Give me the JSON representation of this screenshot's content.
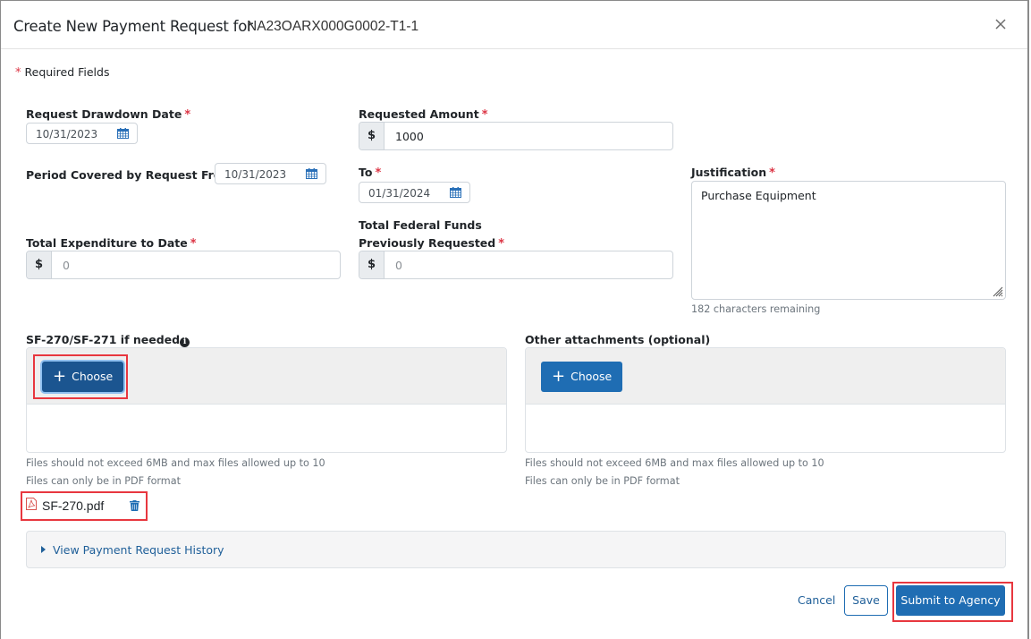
{
  "header": {
    "title": "Create New Payment Request for",
    "award_id": "NA23OARX000G0002-T1-1",
    "close_icon": "close-icon"
  },
  "required_note": {
    "marker": "*",
    "text": "Required Fields"
  },
  "fields": {
    "request_drawdown_date": {
      "label": "Request Drawdown Date",
      "value": "10/31/2023",
      "icon": "calendar-icon"
    },
    "requested_amount": {
      "label": "Requested Amount",
      "prefix": "$",
      "value": "1000"
    },
    "period_from": {
      "label": "Period Covered by Request From",
      "value": "10/31/2023",
      "icon": "calendar-icon"
    },
    "period_to": {
      "label": "To",
      "value": "01/31/2024",
      "icon": "calendar-icon"
    },
    "justification": {
      "label": "Justification",
      "value": "Purchase Equipment",
      "remaining": "182 characters remaining"
    },
    "total_expenditure": {
      "label": "Total Expenditure to Date",
      "prefix": "$",
      "placeholder": "0"
    },
    "federal_funds": {
      "label_line1": "Total Federal Funds",
      "label_line2": "Previously Requested",
      "prefix": "$",
      "placeholder": "0"
    }
  },
  "required_marker": "*",
  "attachments": {
    "sf270": {
      "label": "SF-270/SF-271 if needed",
      "info_icon": "i",
      "choose_label": "Choose",
      "hint_size": "Files should not exceed 6MB and max files allowed up to 10",
      "hint_format": "Files can only be in PDF format",
      "files": [
        {
          "name": "SF-270.pdf",
          "icon": "pdf-file-icon"
        }
      ]
    },
    "other": {
      "label": "Other attachments (optional)",
      "choose_label": "Choose",
      "hint_size": "Files should not exceed 6MB and max files allowed up to 10",
      "hint_format": "Files can only be in PDF format"
    }
  },
  "history": {
    "label": "View Payment Request History"
  },
  "footer": {
    "cancel_label": "Cancel",
    "save_label": "Save",
    "submit_label": "Submit to Agency"
  },
  "colors": {
    "primary": "#1f6db3",
    "link": "#1f5f99",
    "required": "#dc3545",
    "highlight": "#e8373f"
  }
}
